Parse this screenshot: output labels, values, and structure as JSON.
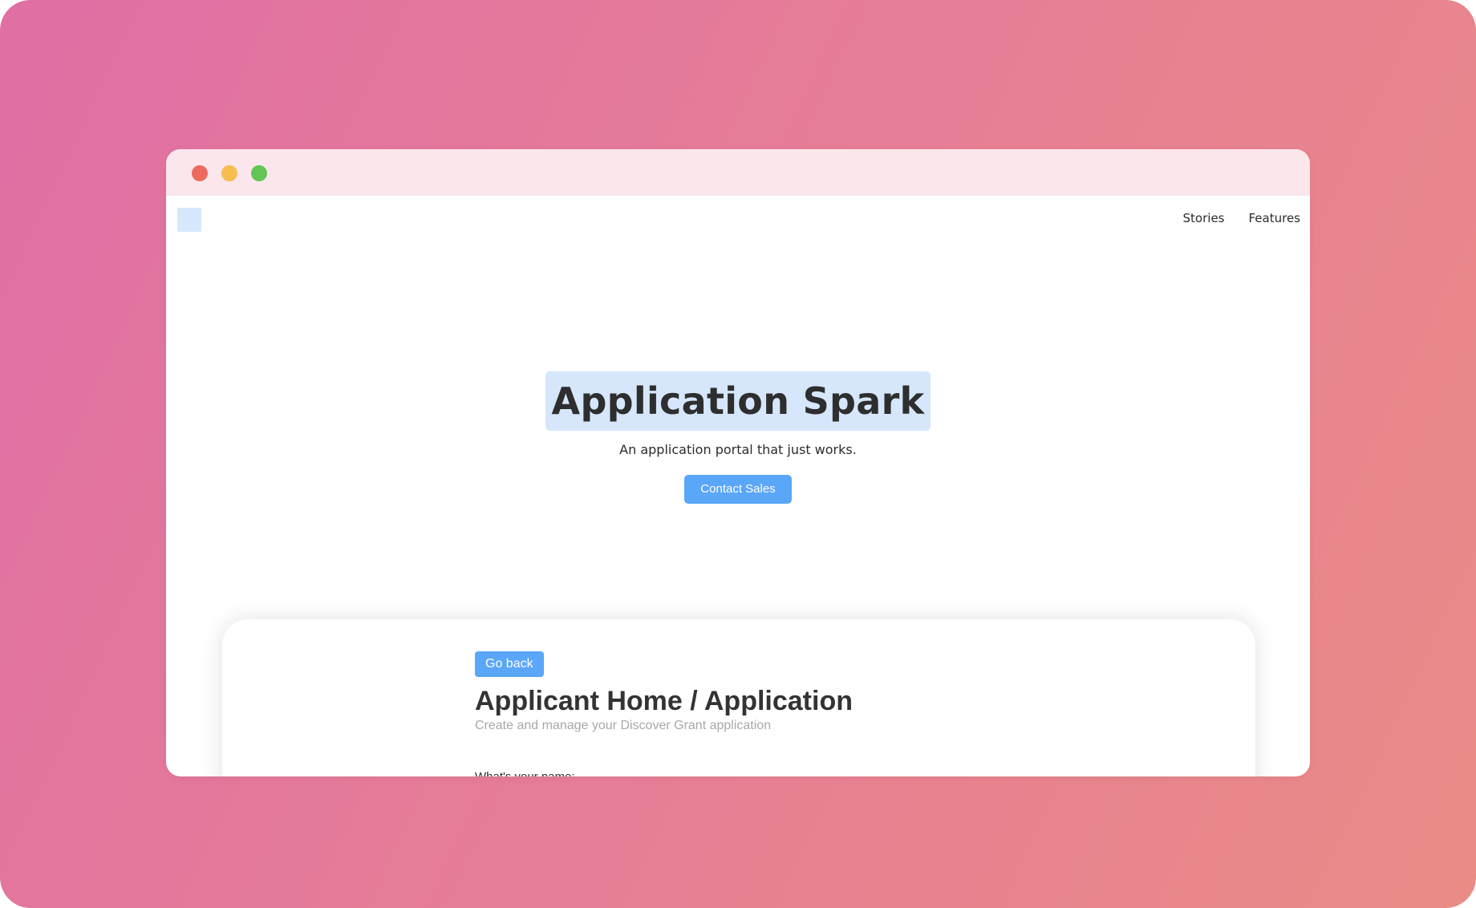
{
  "window": {
    "controls": [
      "close",
      "minimize",
      "maximize"
    ]
  },
  "nav": {
    "links": [
      {
        "label": "Stories"
      },
      {
        "label": "Features"
      }
    ]
  },
  "hero": {
    "title": "Application Spark",
    "subtitle": "An application portal that just works.",
    "cta_label": "Contact Sales"
  },
  "preview": {
    "back_label": "Go back",
    "title": "Applicant Home / Application",
    "subtitle": "Create and manage your Discover Grant application",
    "field_label": "What's your name:"
  },
  "colors": {
    "accent": "#5aa6f8",
    "highlight": "#d6e7fc",
    "titlebar": "#fbe6ec"
  }
}
